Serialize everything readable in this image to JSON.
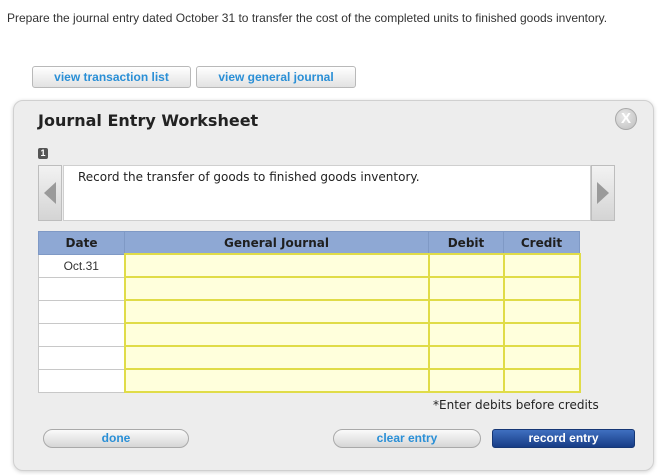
{
  "instructions": "Prepare the journal entry dated October 31 to transfer the cost of the completed units to finished goods inventory.",
  "top_buttons": {
    "transaction_list": "view transaction list",
    "general_journal": "view general journal"
  },
  "worksheet": {
    "title": "Journal Entry Worksheet",
    "close_glyph": "X",
    "step_number": "1",
    "description": "Record the transfer of goods to finished goods inventory.",
    "table": {
      "headers": [
        "Date",
        "General Journal",
        "Debit",
        "Credit"
      ],
      "dates": [
        "Oct.31",
        "",
        "",
        "",
        "",
        ""
      ]
    },
    "footnote": "*Enter debits before credits",
    "buttons": {
      "done": "done",
      "clear": "clear entry",
      "record": "record entry"
    }
  },
  "icons": {
    "close": "close-icon",
    "prev": "chevron-left-icon",
    "next": "chevron-right-icon"
  },
  "colors": {
    "link_blue": "#2a8fd6",
    "header_blue": "#8ea8d4",
    "input_border_yellow": "#e0dc48",
    "primary_button": "#1f4a9a"
  }
}
